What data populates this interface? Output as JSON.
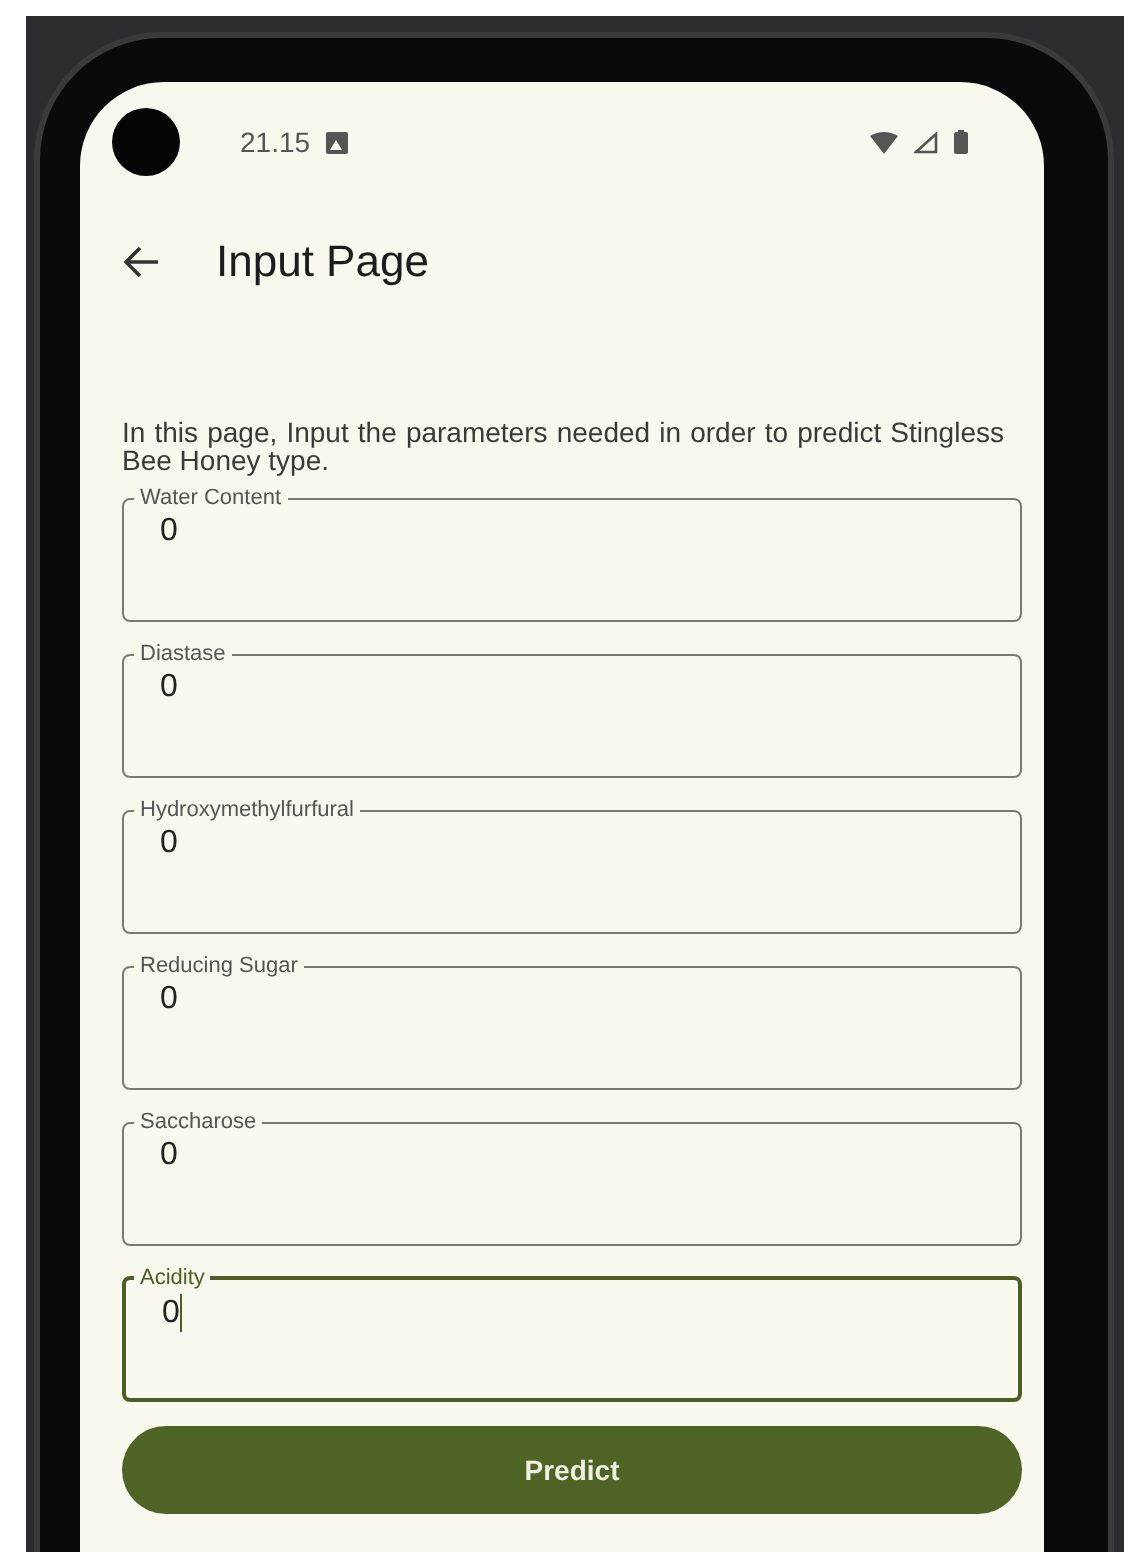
{
  "status_bar": {
    "time": "21.15"
  },
  "app_bar": {
    "title": "Input Page"
  },
  "description": "In this page, Input the parameters needed in order to predict Stingless Bee Honey type.",
  "fields": [
    {
      "label": "Water Content",
      "value": "0",
      "focused": false
    },
    {
      "label": "Diastase",
      "value": "0",
      "focused": false
    },
    {
      "label": "Hydroxymethylfurfural",
      "value": "0",
      "focused": false
    },
    {
      "label": "Reducing Sugar",
      "value": "0",
      "focused": false
    },
    {
      "label": "Saccharose",
      "value": "0",
      "focused": false
    },
    {
      "label": "Acidity",
      "value": "0",
      "focused": true
    }
  ],
  "button": {
    "label": "Predict"
  }
}
